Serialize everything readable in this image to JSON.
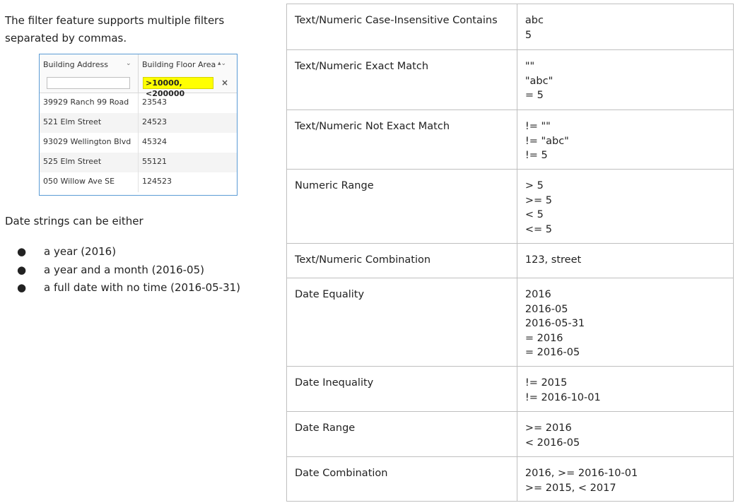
{
  "intro": {
    "line1": "The filter feature supports multiple filters",
    "line2": "separated by commas."
  },
  "grid": {
    "columns": [
      {
        "title": "Building Address",
        "sort_icon": "chevron-down-icon",
        "filter_value": ""
      },
      {
        "title": "Building Floor Area",
        "sort_icon": "sort-asc-chevron-icon",
        "filter_value": ">10000,<200000"
      }
    ],
    "rows": [
      {
        "address": "39929 Ranch 99 Road",
        "area": "23543"
      },
      {
        "address": "521 Elm Street",
        "area": "24523"
      },
      {
        "address": "93029 Wellington Blvd",
        "area": "45324"
      },
      {
        "address": "525 Elm Street",
        "area": "55121"
      },
      {
        "address": "050 Willow Ave SE",
        "area": "124523"
      }
    ]
  },
  "date_intro": "Date strings can be either",
  "date_formats": [
    "a year (2016)",
    "a year and a month (2016-05)",
    "a full date with no time (2016-05-31)"
  ],
  "filter_table": [
    {
      "type": "Text/Numeric Case-Insensitive Contains",
      "examples": [
        "abc",
        "5"
      ]
    },
    {
      "type": "Text/Numeric Exact Match",
      "examples": [
        "\"\"",
        "\"abc\"",
        "= 5"
      ]
    },
    {
      "type": "Text/Numeric Not Exact Match",
      "examples": [
        "!= \"\"",
        "!= \"abc\"",
        "!= 5"
      ]
    },
    {
      "type": "Numeric Range",
      "examples": [
        "> 5",
        ">= 5",
        "< 5",
        "<= 5"
      ]
    },
    {
      "type": "Text/Numeric Combination",
      "examples": [
        "123, street"
      ]
    },
    {
      "type": "Date Equality",
      "examples": [
        "2016",
        "2016-05",
        "2016-05-31",
        "= 2016",
        "= 2016-05"
      ]
    },
    {
      "type": "Date Inequality",
      "examples": [
        "!= 2015",
        "!= 2016-10-01"
      ]
    },
    {
      "type": "Date Range",
      "examples": [
        ">= 2016",
        "< 2016-05"
      ]
    },
    {
      "type": "Date Combination",
      "examples": [
        "2016, >= 2016-10-01",
        ">= 2015, < 2017"
      ]
    }
  ]
}
